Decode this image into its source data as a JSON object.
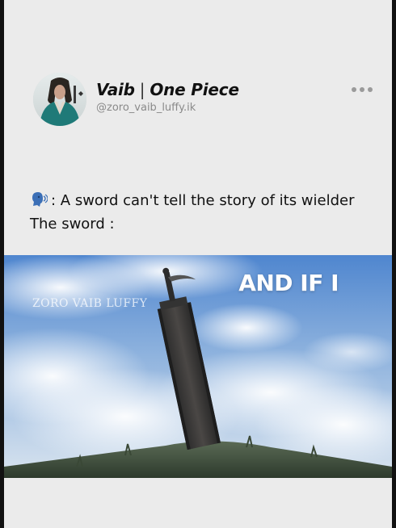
{
  "post": {
    "author_name": "Vaib",
    "author_tag": "One Piece",
    "author_separator": "|",
    "handle": "@zoro_vaib_luffy.ik",
    "text_line_1": ": A sword can't tell the story of its wielder",
    "text_line_2": "The sword :"
  },
  "media": {
    "overlay_caption": "AND IF I",
    "watermark": "ZORO VAIB LUFFY"
  },
  "icons": {
    "speaking_head": "speaking-head-icon",
    "more": "more-options-icon"
  },
  "colors": {
    "background": "#ebebeb",
    "text": "#111111",
    "handle": "#8a8a8a",
    "sky_top": "#3e78c7",
    "grass": "#3c4a3a"
  }
}
